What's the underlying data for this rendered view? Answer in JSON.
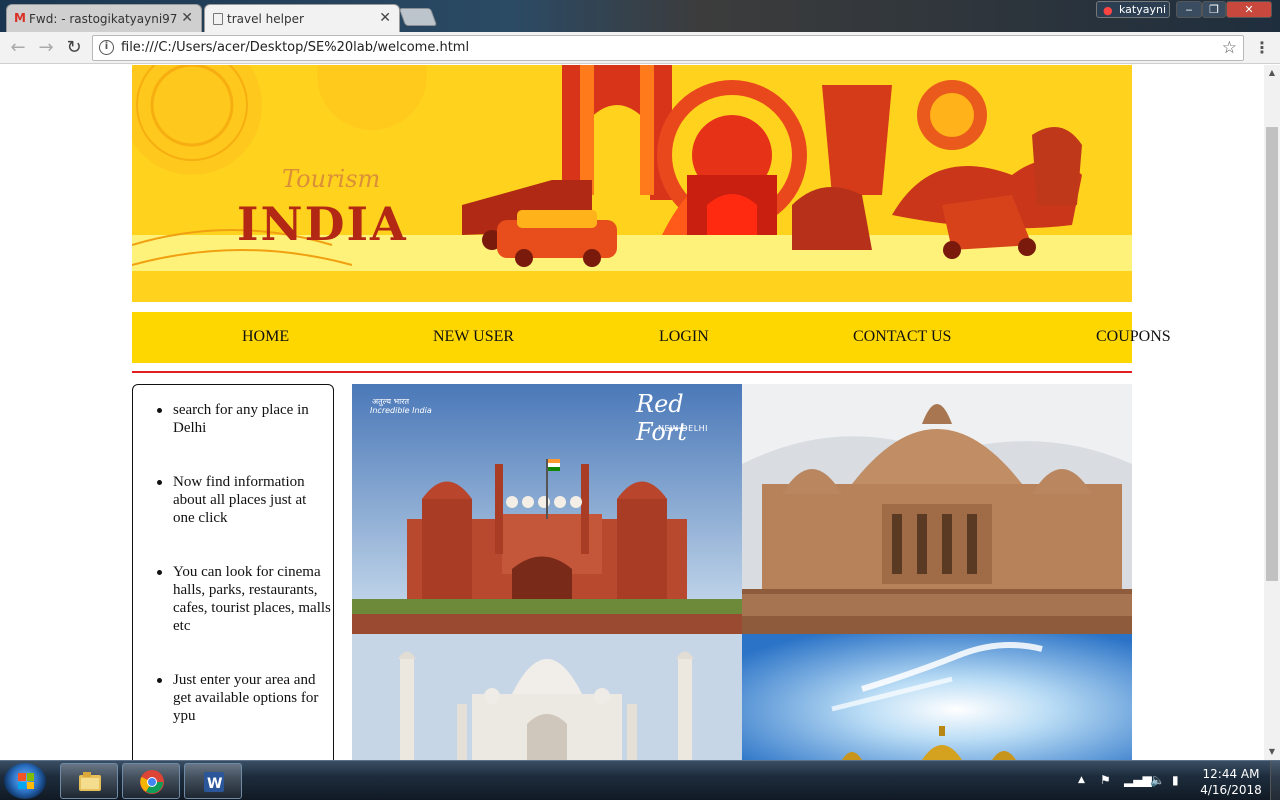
{
  "browser": {
    "tabs": [
      {
        "title": "Fwd: - rastogikatyayni97",
        "favicon": "gmail-icon",
        "active": false
      },
      {
        "title": "travel helper",
        "favicon": "page-icon",
        "active": true
      }
    ],
    "profile_name": "katyayni",
    "url": "file:///C:/Users/acer/Desktop/SE%20lab/welcome.html",
    "tab_close": "✕",
    "icons": {
      "back": "arrow-left-icon",
      "forward": "arrow-right-icon",
      "reload": "reload-icon",
      "info": "info-icon",
      "bookmark": "star-icon",
      "menu": "kebab-menu-icon"
    }
  },
  "page": {
    "banner": {
      "title_script": "Tourism",
      "title_main": "INDIA"
    },
    "nav": {
      "items": [
        "HOME",
        "NEW USER",
        "LOGIN",
        "CONTACT US",
        "COUPONS"
      ]
    },
    "sidebar": {
      "items": [
        "search for any place in Delhi",
        "Now find information about all places just at one click",
        "You can look for cinema halls, parks, restaurants, cafes, tourist places, malls etc",
        "Just enter your area and get available options for ypu"
      ]
    },
    "gallery": {
      "photo1": {
        "title": "Red Fort",
        "subtitle": "NEW DELHI",
        "logo_line1": "अतुल्य भारत",
        "logo_line2": "Incredible India"
      }
    },
    "colors": {
      "banner_bg": "#ffd21e",
      "nav_bg": "#ffd700",
      "divider": "#e02020"
    }
  },
  "taskbar": {
    "apps": [
      "windows-explorer-icon",
      "chrome-icon",
      "word-icon"
    ],
    "time": "12:44 AM",
    "date": "4/16/2018"
  }
}
